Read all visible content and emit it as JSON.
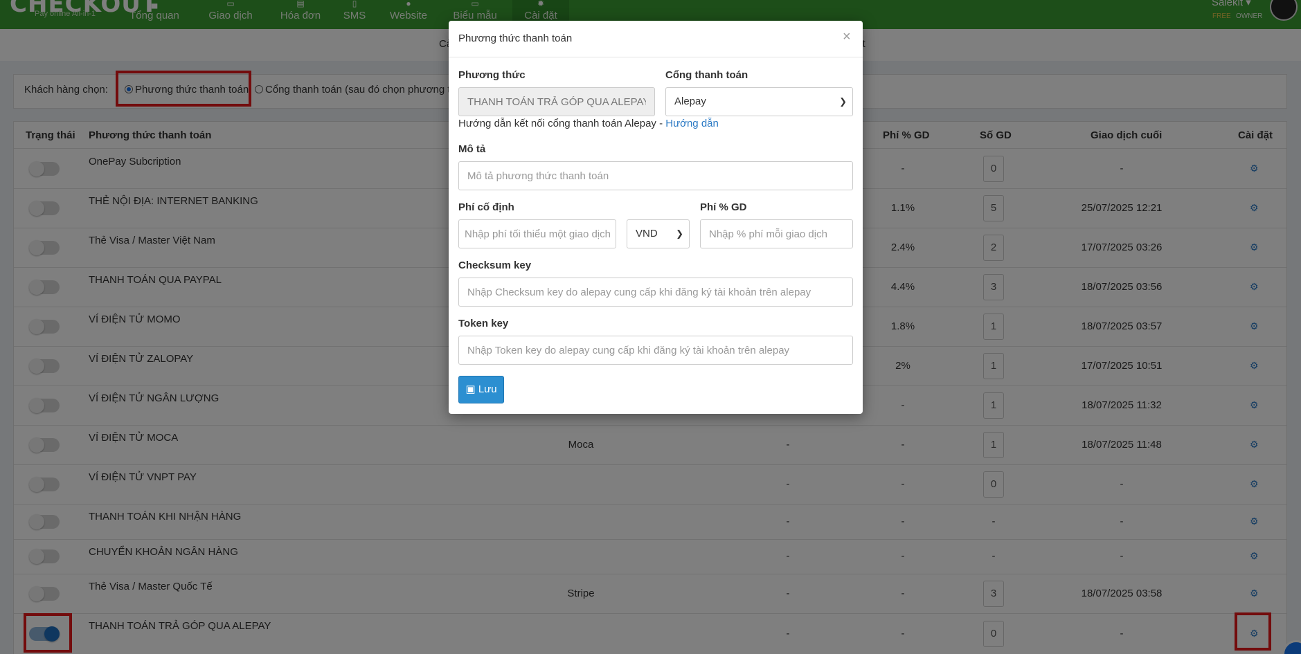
{
  "nav": {
    "logo": "CHECKOUT",
    "logo_sub": "Pay online All-in-1",
    "items": [
      "Tổng quan",
      "Giao dịch",
      "Hóa đơn",
      "SMS",
      "Website",
      "Biểu mẫu",
      "Cài đặt"
    ],
    "user": "Salekit",
    "plan": "FREE",
    "role": "OWNER"
  },
  "subtabs": {
    "a": "Cả",
    "b": "ct"
  },
  "choose": {
    "label": "Khách hàng chọn:",
    "opt1": "Phương thức thanh toán",
    "opt2": "Cổng thanh toán (sau đó chọn phương th"
  },
  "table": {
    "headers": {
      "status": "Trạng thái",
      "method": "Phương thức thanh toán",
      "fee_pct": "Phí % GD",
      "count": "Số GD",
      "last": "Giao dịch cuối",
      "settings": "Cài đặt"
    },
    "rows": [
      {
        "on": false,
        "method": "OnePay Subcription",
        "gateway": "",
        "fixed": "",
        "fee_pct": "-",
        "count": "0",
        "last": "-"
      },
      {
        "on": false,
        "method": "THẺ NỘI ĐỊA: INTERNET BANKING",
        "gateway": "",
        "fixed": "",
        "fee_pct": "1.1%",
        "count": "5",
        "last": "25/07/2025 12:21"
      },
      {
        "on": false,
        "method": "Thẻ Visa / Master Việt Nam",
        "gateway": "",
        "fixed": "",
        "fee_pct": "2.4%",
        "count": "2",
        "last": "17/07/2025 03:26"
      },
      {
        "on": false,
        "method": "THANH TOÁN QUA PAYPAL",
        "gateway": "",
        "fixed": "",
        "fee_pct": "4.4%",
        "count": "3",
        "last": "18/07/2025 03:56"
      },
      {
        "on": false,
        "method": "VÍ ĐIỆN TỬ MOMO",
        "gateway": "",
        "fixed": "",
        "fee_pct": "1.8%",
        "count": "1",
        "last": "18/07/2025 03:57"
      },
      {
        "on": false,
        "method": "VÍ ĐIỆN TỬ ZALOPAY",
        "gateway": "",
        "fixed": "",
        "fee_pct": "2%",
        "count": "1",
        "last": "17/07/2025 10:51"
      },
      {
        "on": false,
        "method": "VÍ ĐIỆN TỬ NGÂN LƯỢNG",
        "gateway": "",
        "fixed": "",
        "fee_pct": "-",
        "count": "1",
        "last": "18/07/2025 11:32"
      },
      {
        "on": false,
        "method": "VÍ ĐIỆN TỬ MOCA",
        "gateway": "Moca",
        "fixed": "-",
        "fee_pct": "-",
        "count": "1",
        "last": "18/07/2025 11:48"
      },
      {
        "on": false,
        "method": "VÍ ĐIỆN TỬ VNPT PAY",
        "gateway": "",
        "fixed": "-",
        "fee_pct": "-",
        "count": "0",
        "last": "-"
      },
      {
        "on": false,
        "method": "THANH TOÁN KHI NHẬN HÀNG",
        "gateway": "",
        "fixed": "-",
        "fee_pct": "-",
        "count": "-",
        "last": "-"
      },
      {
        "on": false,
        "method": "CHUYỂN KHOẢN NGÂN HÀNG",
        "gateway": "",
        "fixed": "-",
        "fee_pct": "-",
        "count": "-",
        "last": "-"
      },
      {
        "on": false,
        "method": "Thẻ Visa / Master Quốc Tế",
        "gateway": "Stripe",
        "fixed": "-",
        "fee_pct": "-",
        "count": "3",
        "last": "18/07/2025 03:58"
      },
      {
        "on": true,
        "method": "THANH TOÁN TRẢ GÓP QUA ALEPAY",
        "gateway": "",
        "fixed": "-",
        "fee_pct": "-",
        "count": "0",
        "last": "-"
      }
    ]
  },
  "modal": {
    "title": "Phương thức thanh toán",
    "close": "×",
    "method_label": "Phương thức",
    "method_value": "THANH TOÁN TRẢ GÓP QUA ALEPAY",
    "gateway_label": "Cổng thanh toán",
    "gateway_value": "Alepay",
    "hint_text": "Hướng dẫn kết nối cổng thanh toán Alepay - ",
    "hint_link": "Hướng dẫn",
    "desc_label": "Mô tả",
    "desc_placeholder": "Mô tả phương thức thanh toán",
    "fixed_label": "Phí cố định",
    "fixed_placeholder": "Nhập phí tối thiểu một giao dịch",
    "currency": "VND",
    "pct_label": "Phí % GD",
    "pct_placeholder": "Nhập % phí mỗi giao dịch",
    "checksum_label": "Checksum key",
    "checksum_placeholder": "Nhập Checksum key do alepay cung cấp khi đăng ký tài khoản trên alepay",
    "token_label": "Token key",
    "token_placeholder": "Nhập Token key do alepay cung cấp khi đăng ký tài khoản trên alepay",
    "save": "Lưu"
  },
  "colors": {
    "nav": "#3a9d32",
    "accent": "#2c8fd1",
    "highlight": "#e6191a"
  }
}
